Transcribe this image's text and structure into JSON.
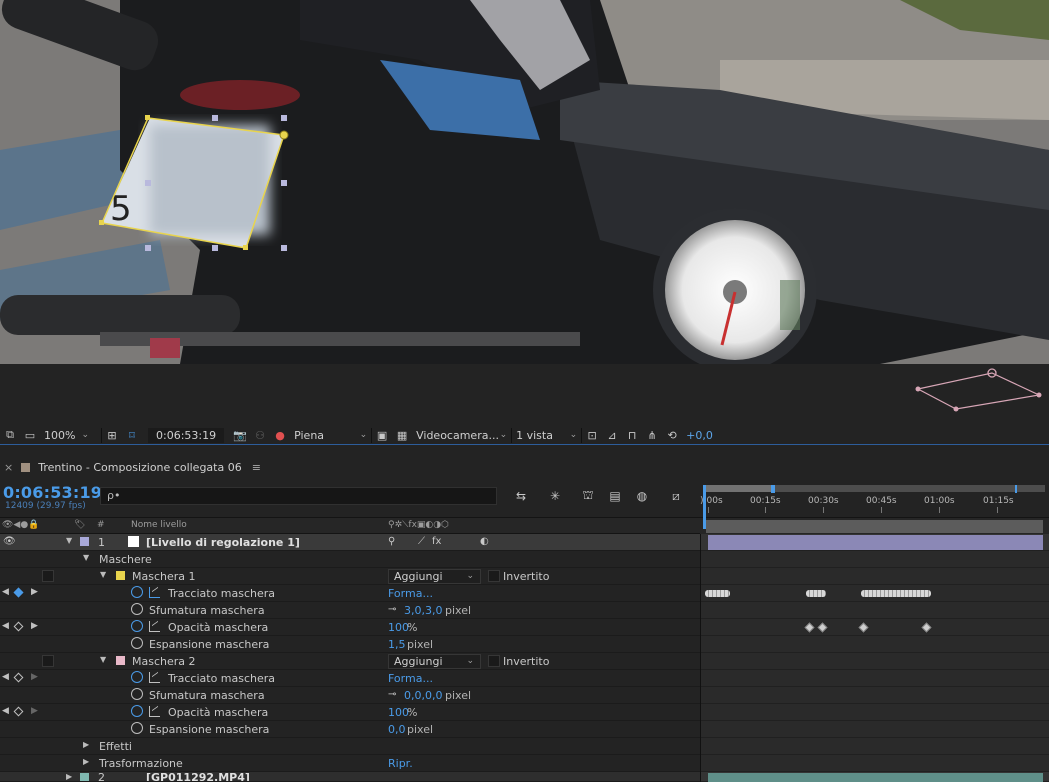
{
  "viewer_toolbar": {
    "zoom": "100%",
    "timecode": "0:06:53:19",
    "resolution": "Piena",
    "camera": "Videocamera...",
    "views": "1 vista",
    "exposure": "+0,0"
  },
  "panel": {
    "tab_title": "Trentino - Composizione collegata 06",
    "timecode": "0:06:53:19",
    "fps": "12409 (29.97 fps)",
    "search_placeholder": "ρ•"
  },
  "ruler": {
    "labels": [
      "):00s",
      "00:15s",
      "00:30s",
      "00:45s",
      "01:00s",
      "01:15s"
    ]
  },
  "columns": {
    "hash": "#",
    "name": "Nome livello"
  },
  "layers": {
    "layer1": {
      "index": "1",
      "name": "[Livello di regolazione 1]",
      "label_color": "#a9a9d9"
    },
    "masks_group": "Maschere",
    "mask1": {
      "name": "Maschera 1",
      "color": "#e8d44d",
      "mode": "Aggiungi",
      "inverted_label": "Invertito",
      "path_label": "Tracciato maschera",
      "path_value": "Forma...",
      "feather_label": "Sfumatura maschera",
      "feather_value": "3,0,3,0",
      "feather_unit": "pixel",
      "opacity_label": "Opacità maschera",
      "opacity_value": "100",
      "opacity_unit": "%",
      "expansion_label": "Espansione maschera",
      "expansion_value": "1,5",
      "expansion_unit": "pixel"
    },
    "mask2": {
      "name": "Maschera 2",
      "color": "#e8b8c8",
      "mode": "Aggiungi",
      "inverted_label": "Invertito",
      "path_label": "Tracciato maschera",
      "path_value": "Forma...",
      "feather_label": "Sfumatura maschera",
      "feather_value": "0,0,0,0",
      "feather_unit": "pixel",
      "opacity_label": "Opacità maschera",
      "opacity_value": "100",
      "opacity_unit": "%",
      "expansion_label": "Espansione maschera",
      "expansion_value": "0,0",
      "expansion_unit": "pixel"
    },
    "effects": "Effetti",
    "transform": "Trasformazione",
    "transform_value": "Ripr.",
    "layer2": {
      "index": "2",
      "name": "[GP011292.MP4]",
      "label_color": "#7fb8b0"
    }
  },
  "colors": {
    "accent": "#4a9be8",
    "panel_bg": "#232323",
    "mask_path_highlight": "#e8d44d"
  }
}
